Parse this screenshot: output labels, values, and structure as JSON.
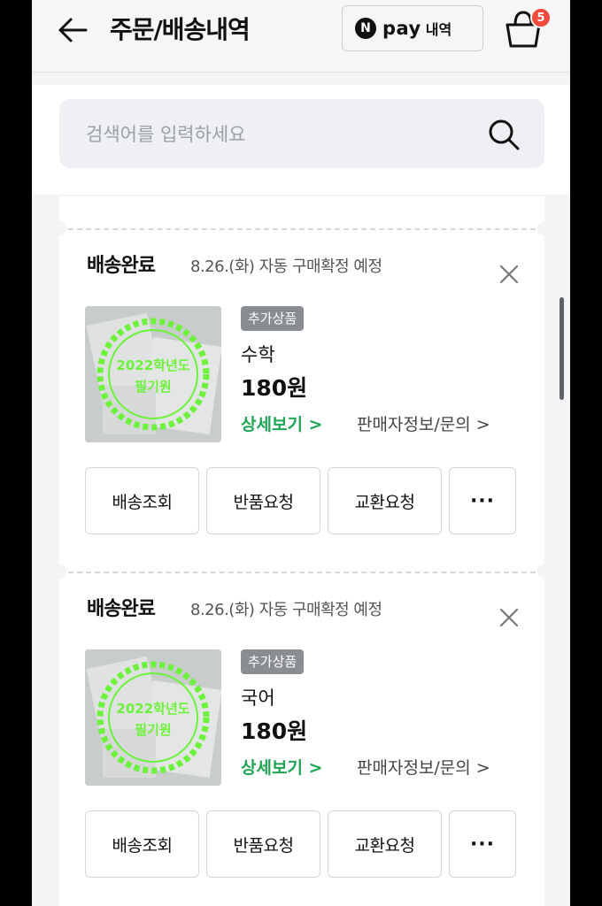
{
  "header": {
    "title": "주문/배송내역",
    "npay": {
      "logo": "N",
      "pay": "pay",
      "label": "내역"
    },
    "cart_badge": "5",
    "icons": {
      "back": "arrow-left-icon",
      "cart": "shopping-bag-icon"
    }
  },
  "search": {
    "placeholder": "검색어를 입력하세요",
    "icon": "search-icon"
  },
  "orders": [
    {
      "status": "배송완료",
      "date_note": "8.26.(화) 자동 구매확정 예정",
      "tag": "추가상품",
      "product": "수학",
      "price": "180원",
      "detail_link": "상세보기 >",
      "seller_link": "판매자정보/문의 >",
      "thumb_stamp": {
        "line1": "2022학년도",
        "line2": "필기원"
      },
      "actions": [
        "배송조회",
        "반품요청",
        "교환요청",
        "···"
      ]
    },
    {
      "status": "배송완료",
      "date_note": "8.26.(화) 자동 구매확정 예정",
      "tag": "추가상품",
      "product": "국어",
      "price": "180원",
      "detail_link": "상세보기 >",
      "seller_link": "판매자정보/문의 >",
      "thumb_stamp": {
        "line1": "2022학년도",
        "line2": "필기원"
      },
      "actions": [
        "배송조회",
        "반품요청",
        "교환요청",
        "···"
      ]
    }
  ],
  "colors": {
    "green": "#1fa554",
    "badge": "#f04b3d",
    "stamp": "#6cf23a"
  }
}
